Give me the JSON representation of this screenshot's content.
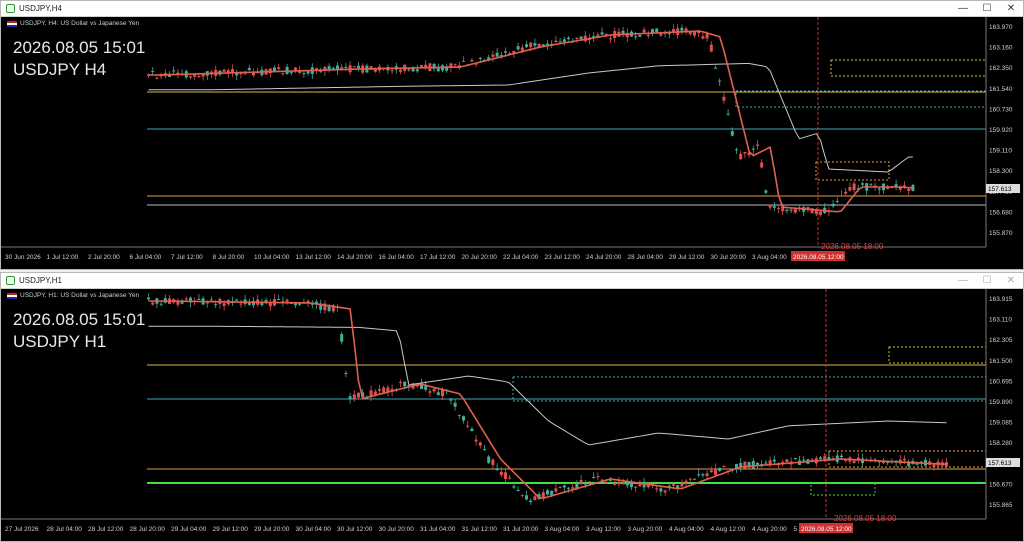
{
  "windows": [
    {
      "id": "h4",
      "title": "USDJPY,H4",
      "symbol_desc": "USDJPY, H4: US Dollar vs Japanese Yen",
      "overlay_date": "2026.08.05 15:01",
      "overlay_pair": "USDJPY H4",
      "price_labels": [
        "163.970",
        "163.160",
        "162.350",
        "161.540",
        "160.730",
        "159.920",
        "159.110",
        "158.300",
        "157.490",
        "156.680",
        "155.870"
      ],
      "current_price": "157.613",
      "time_labels": [
        "30 Jun 2026",
        "1 Jul 12:00",
        "2 Jul 20:00",
        "6 Jul 04:00",
        "7 Jul 12:00",
        "8 Jul 20:00",
        "10 Jul 04:00",
        "13 Jul 12:00",
        "14 Jul 20:00",
        "16 Jul 04:00",
        "17 Jul 12:00",
        "20 Jul 20:00",
        "22 Jul 04:00",
        "23 Jul 12:00",
        "24 Jul 20:00",
        "28 Jul 04:00",
        "29 Jul 12:00",
        "30 Jul 20:00",
        "3 Aug 04:00",
        "4"
      ],
      "crosshair_time": "2026.08.05 12:00",
      "crosshair_label": "2026.08.05 18:00"
    },
    {
      "id": "h1",
      "title": "USDJPY,H1",
      "symbol_desc": "USDJPY, H1: US Dollar vs Japanese Yen",
      "overlay_date": "2026.08.05 15:01",
      "overlay_pair": "USDJPY H1",
      "price_labels": [
        "163.915",
        "163.110",
        "162.305",
        "161.500",
        "160.695",
        "159.890",
        "159.085",
        "158.280",
        "157.475",
        "156.670",
        "155.865"
      ],
      "current_price": "157.613",
      "time_labels": [
        "27 Jul 2026",
        "28 Jul 04:00",
        "28 Jul 12:00",
        "28 Jul 20:00",
        "29 Jul 04:00",
        "29 Jul 12:00",
        "29 Jul 20:00",
        "30 Jul 04:00",
        "30 Jul 12:00",
        "30 Jul 20:00",
        "31 Jul 04:00",
        "31 Jul 12:00",
        "31 Jul 20:00",
        "3 Aug 04:00",
        "3 Aug 12:00",
        "3 Aug 20:00",
        "4 Aug 04:00",
        "4 Aug 12:00",
        "4 Aug 20:00",
        "5 Aug"
      ],
      "crosshair_time": "2026.08.05 12:00",
      "crosshair_label": "2026.08.05 18:00"
    }
  ],
  "controls": {
    "minimize": "—",
    "maximize": "☐",
    "close": "✕"
  },
  "colors": {
    "up": "#3fb0a0",
    "down": "#e05050",
    "ema": "#e06050",
    "sma": "#c8c8c8",
    "yellow": "#d4c030",
    "cyan": "#40a8b8",
    "orange": "#e0a040",
    "green": "#40e040",
    "crosshair": "#d03030"
  }
}
